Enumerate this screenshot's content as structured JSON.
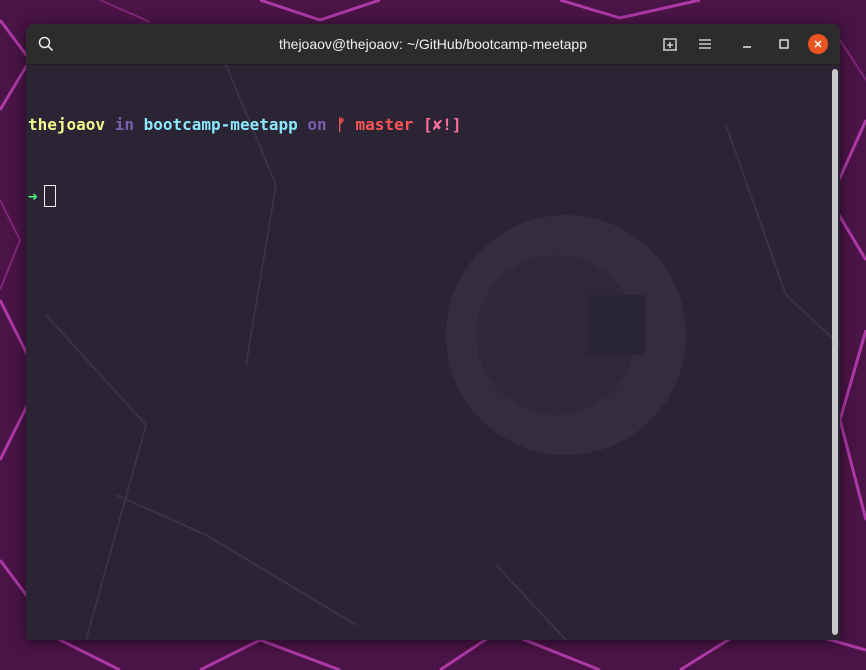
{
  "window": {
    "title": "thejoaov@thejoaov: ~/GitHub/bootcamp-meetapp"
  },
  "titlebar_buttons": {
    "search_icon": "search-icon",
    "new_tab_icon": "new-tab-icon",
    "menu_icon": "hamburger-menu-icon",
    "minimize_icon": "minimize-icon",
    "maximize_icon": "maximize-icon",
    "close_icon": "close-icon"
  },
  "terminal": {
    "prompt": {
      "user": "thejoaov",
      "in_word": "in",
      "directory": "bootcamp-meetapp",
      "on_word": "on",
      "branch_symbol": "ᚠ",
      "branch": "master",
      "status": "[✘!]"
    },
    "input_arrow": "➜"
  },
  "colors": {
    "accent_close": "#e95420",
    "user": "#f1fa8c",
    "keyword": "#7a5fae",
    "directory": "#8be9fd",
    "branch": "#ff5555",
    "status": "#ff6e9a",
    "arrow": "#50fa7b",
    "terminal_bg": "#2b2635",
    "wallpaper": "#4a1446"
  }
}
